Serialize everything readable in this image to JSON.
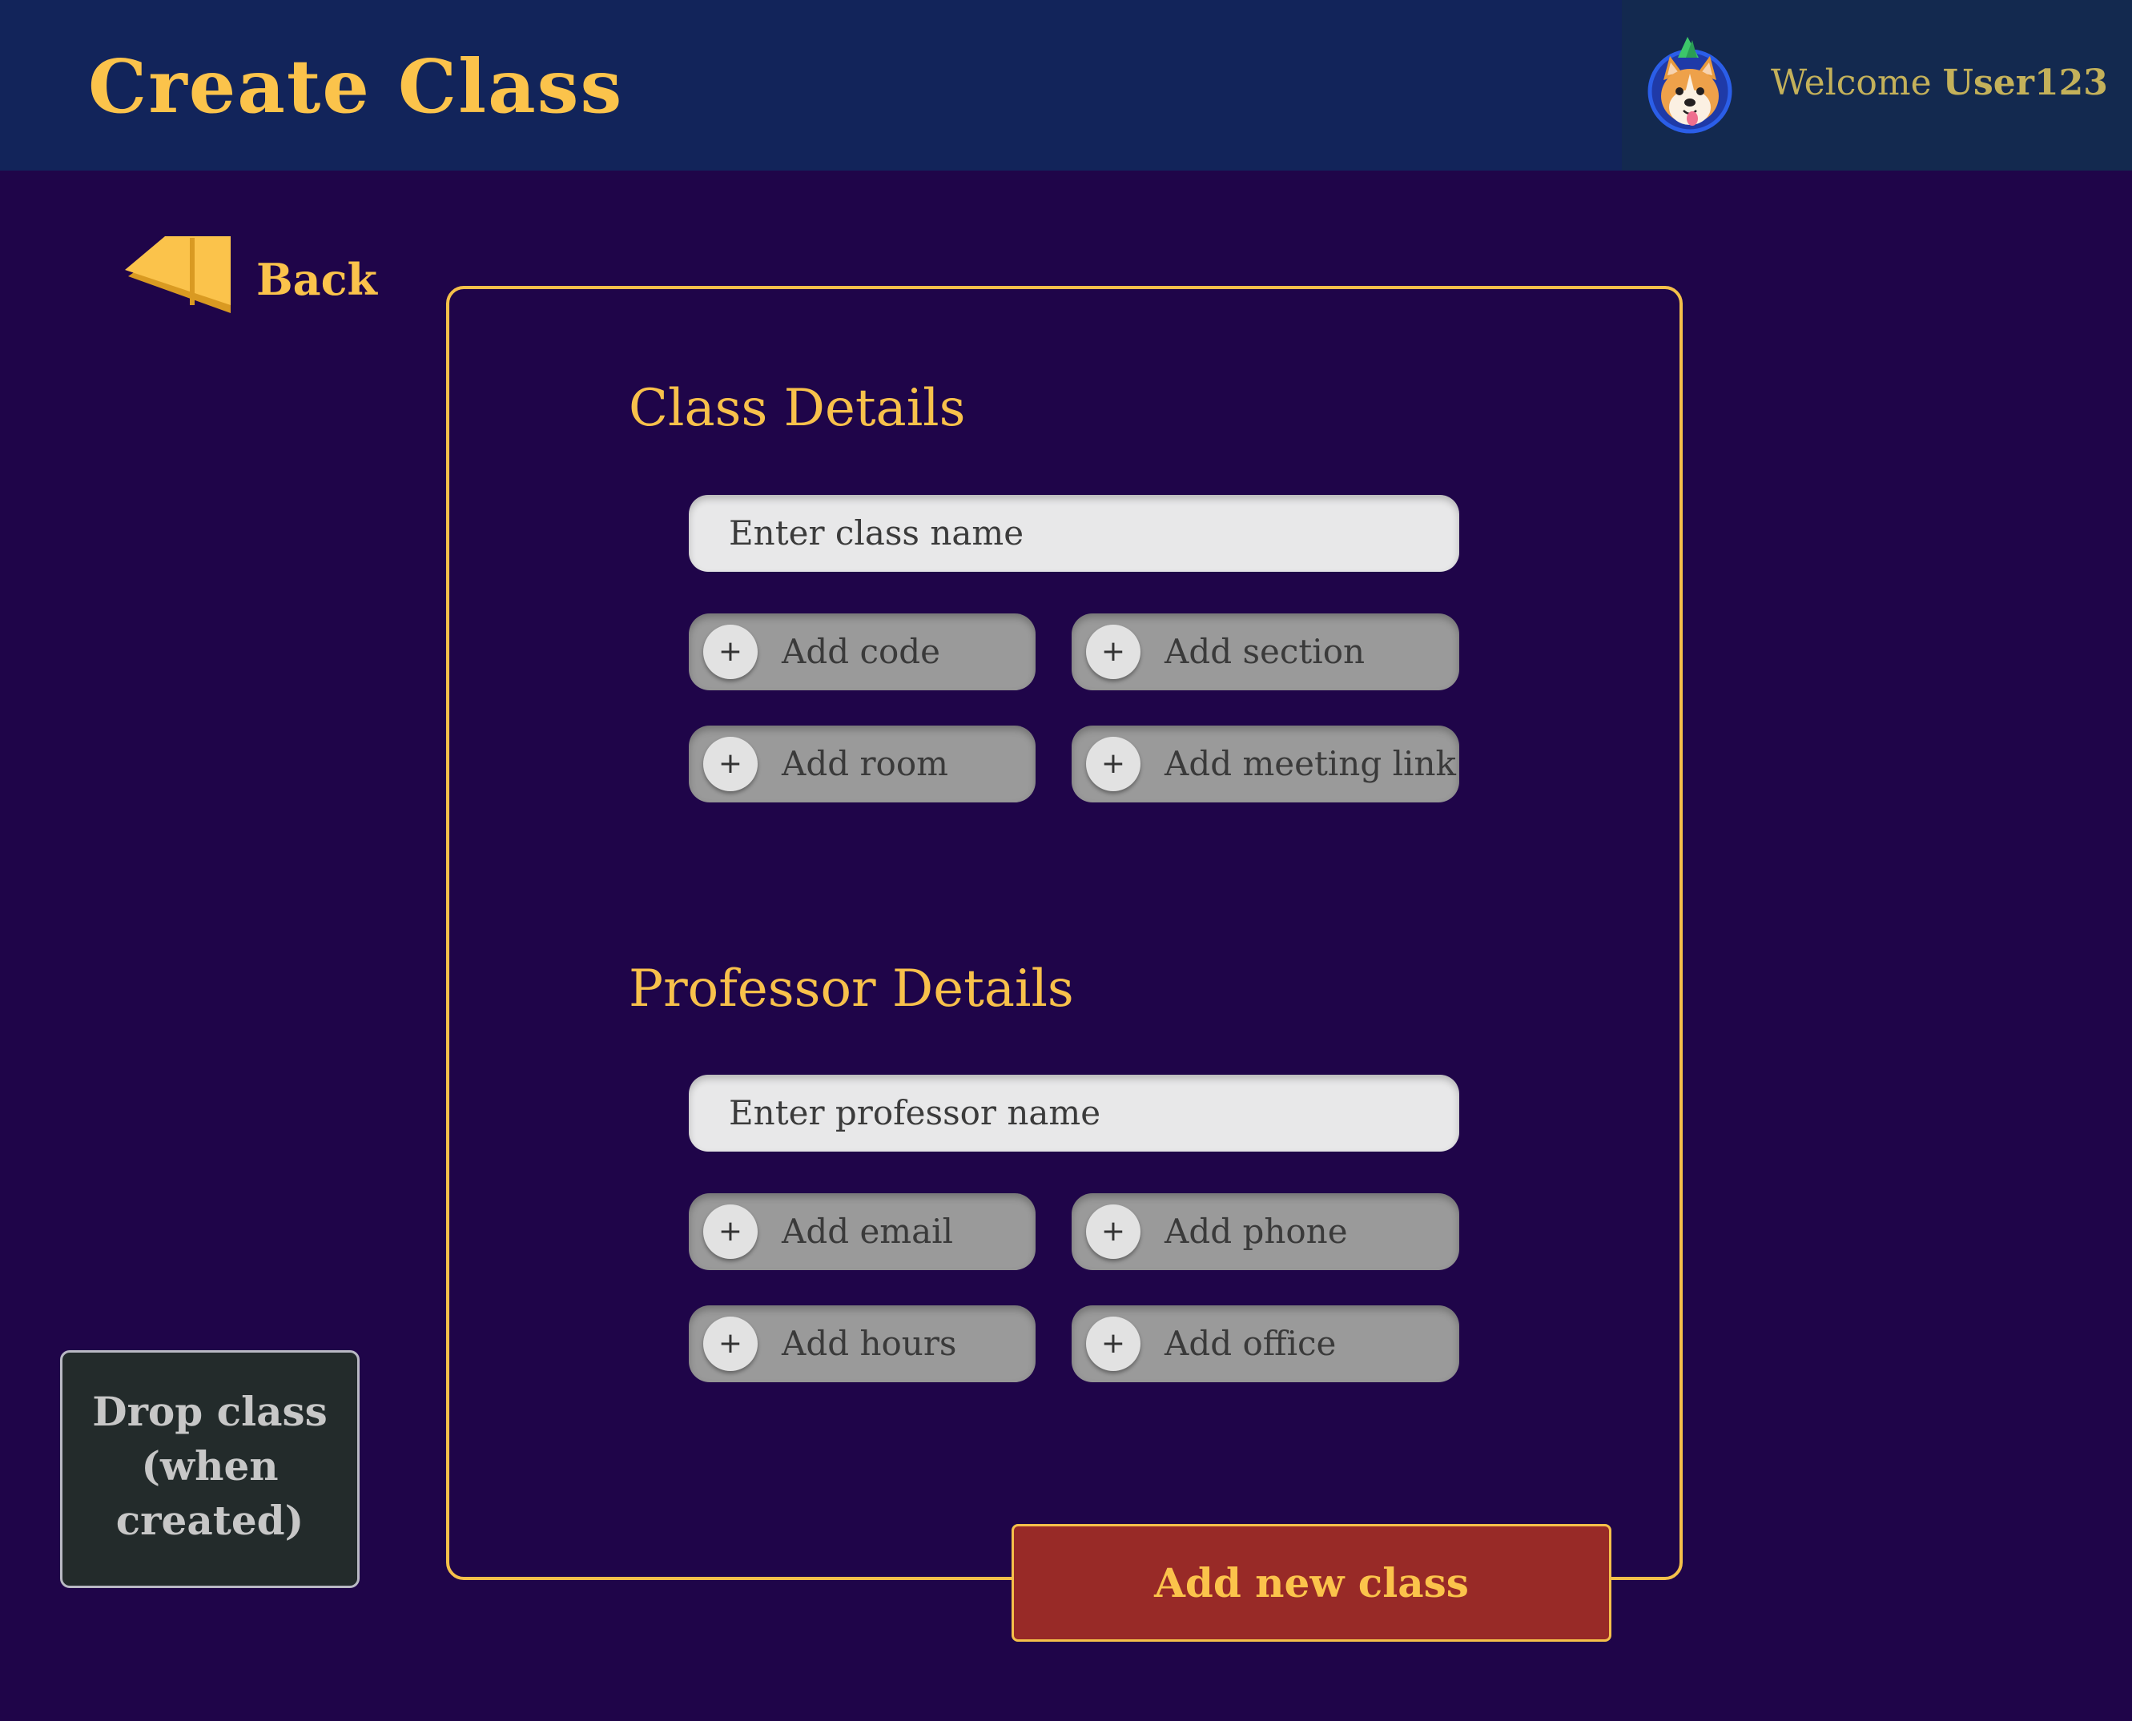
{
  "header": {
    "title": "Create Class",
    "welcome_text": "Welcome",
    "user_name": "User123",
    "avatar_icon": "corgi-avatar-icon"
  },
  "back": {
    "label": "Back",
    "icon": "rewind-arrow-icon"
  },
  "class_details": {
    "heading": "Class Details",
    "name_placeholder": "Enter class name",
    "add_buttons": [
      "Add code",
      "Add section",
      "Add room",
      "Add meeting link"
    ]
  },
  "professor_details": {
    "heading": "Professor Details",
    "name_placeholder": "Enter professor name",
    "add_buttons": [
      "Add email",
      "Add phone",
      "Add hours",
      "Add office"
    ]
  },
  "actions": {
    "add_new_class": "Add new class",
    "drop_class": "Drop class (when created)"
  },
  "colors": {
    "background": "#1f0549",
    "header": "#12245a",
    "user_panel": "#13294f",
    "accent": "#fbc34b",
    "add_class_button": "#982a27",
    "drop_class_button": "#232b2b"
  },
  "plus_glyph": "+"
}
